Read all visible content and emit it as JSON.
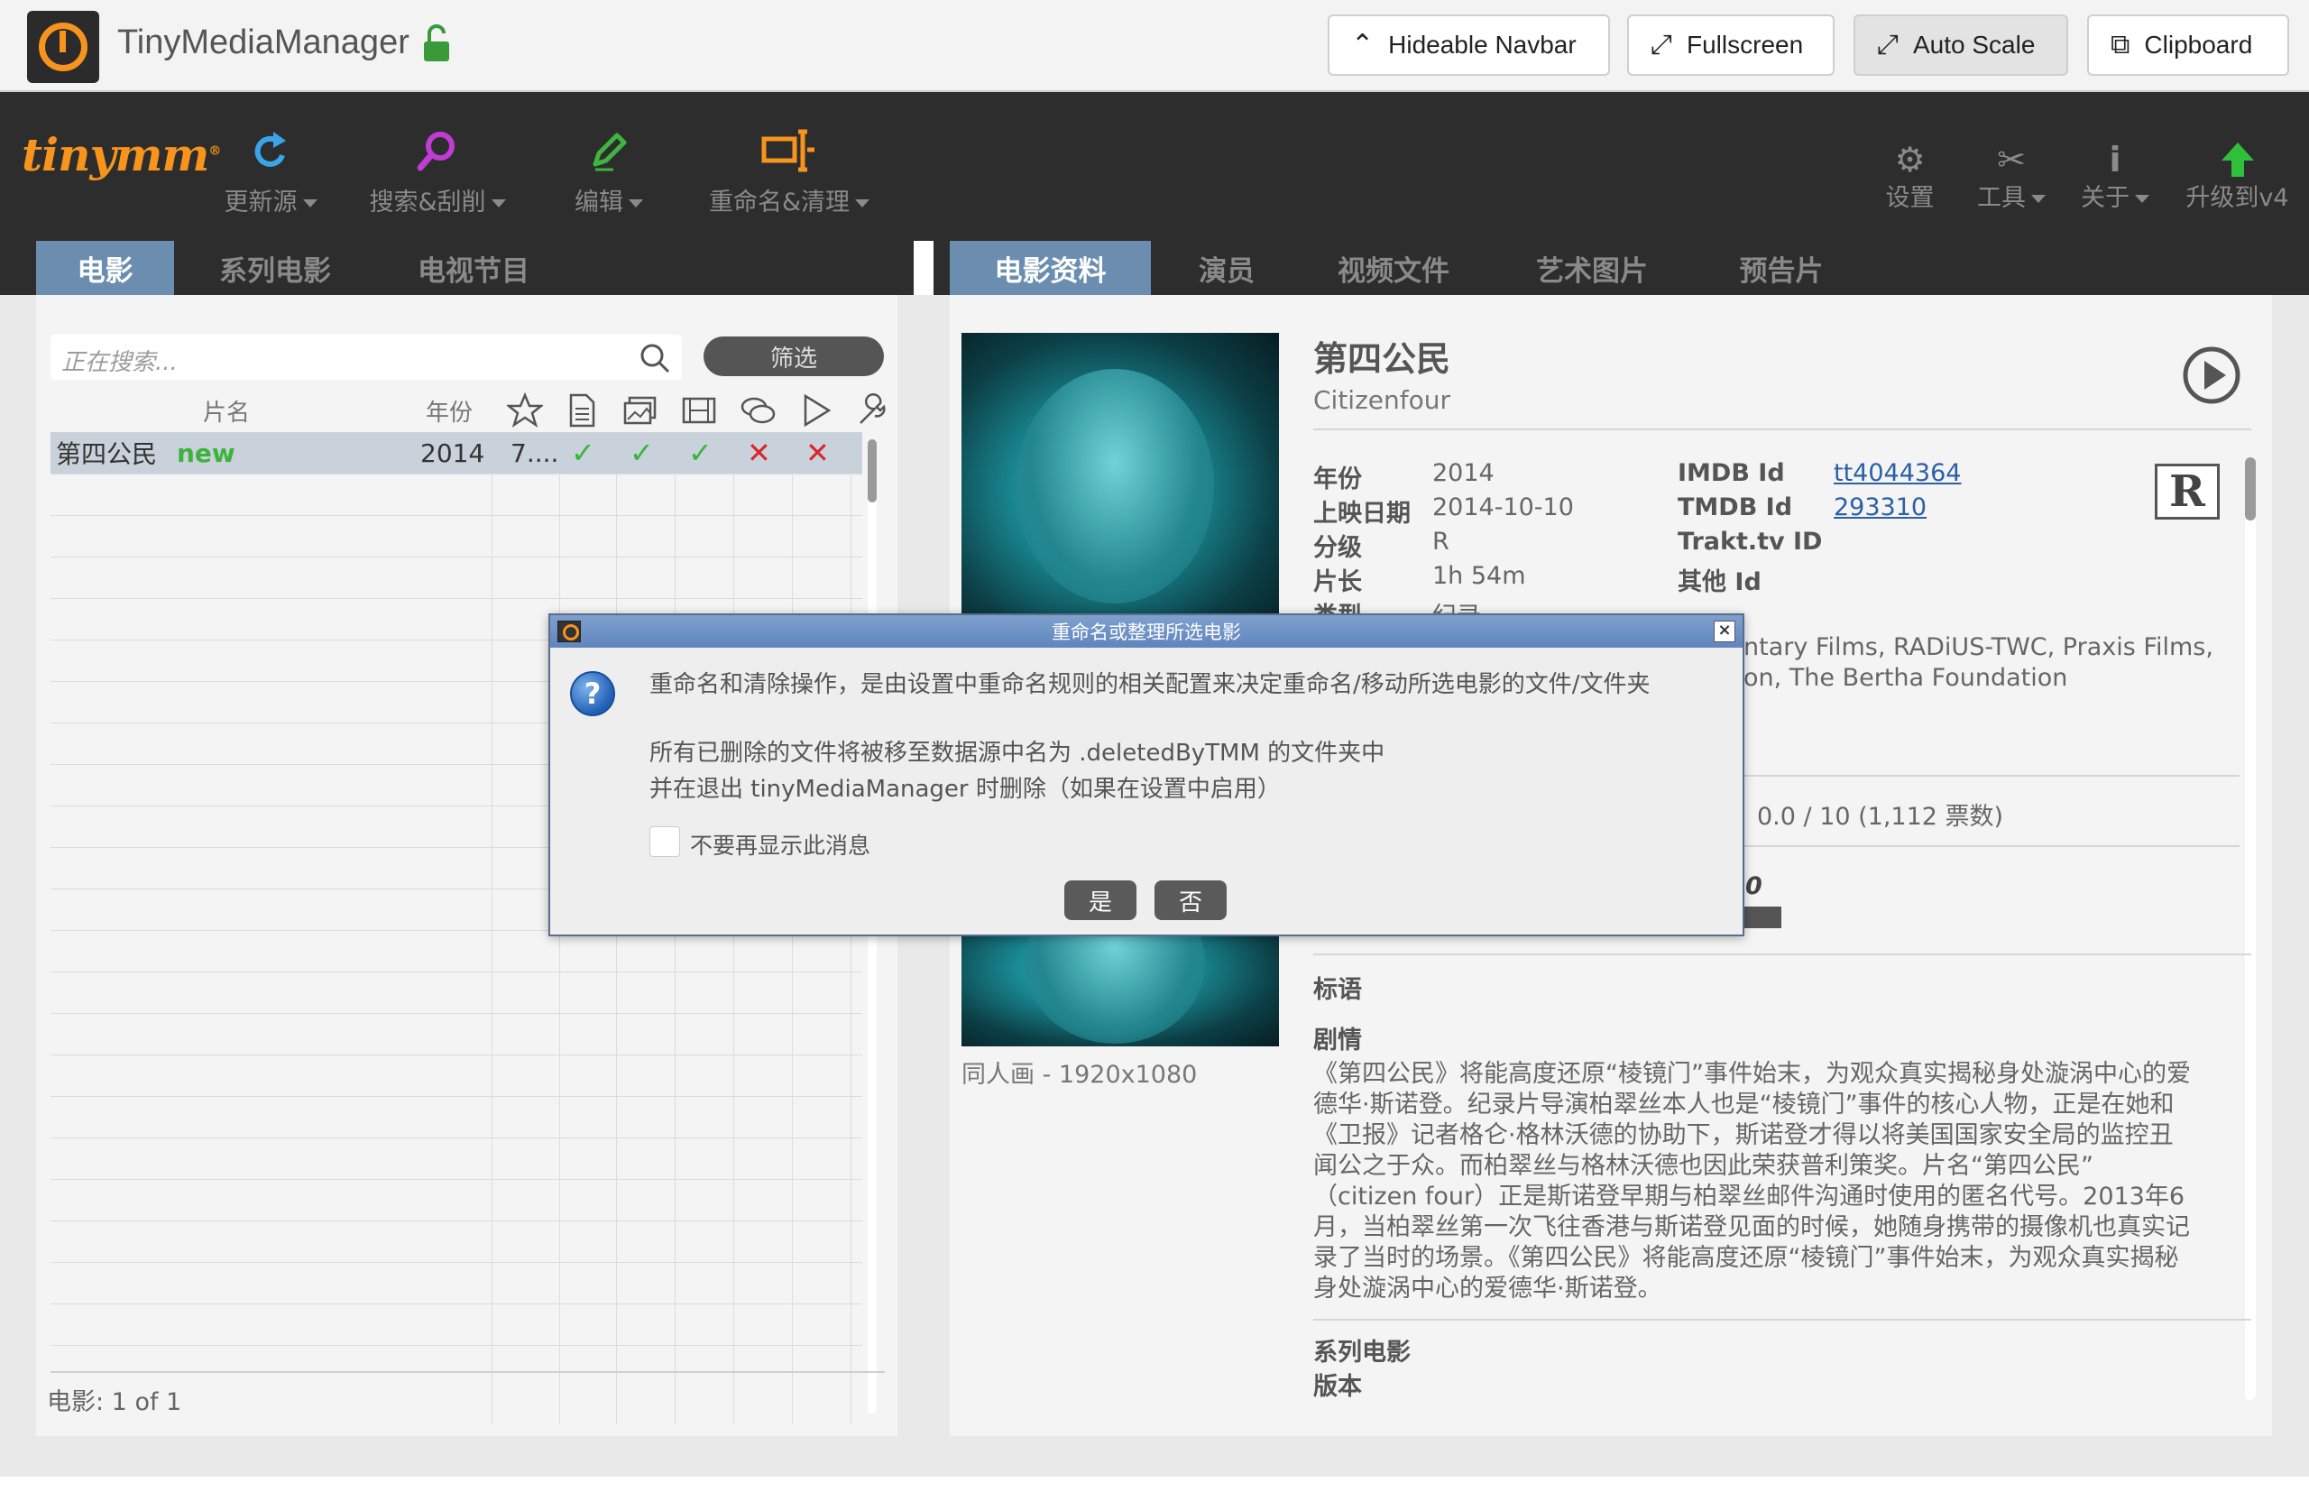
{
  "topbar": {
    "app_title": "TinyMediaManager",
    "buttons": {
      "hideable_navbar": "Hideable Navbar",
      "fullscreen": "Fullscreen",
      "auto_scale": "Auto Scale",
      "clipboard": "Clipboard"
    }
  },
  "toolbar": {
    "brand": "tinymm",
    "items": {
      "update": "更新源",
      "search": "搜索&刮削",
      "edit": "编辑",
      "rename": "重命名&清理",
      "settings": "设置",
      "tools": "工具",
      "about": "关于",
      "upgrade": "升级到v4"
    }
  },
  "left_tabs": [
    "电影",
    "系列电影",
    "电视节目"
  ],
  "right_tabs": [
    "电影资料",
    "演员",
    "视频文件",
    "艺术图片",
    "预告片"
  ],
  "movie_list": {
    "search_placeholder": "正在搜索...",
    "filter_label": "筛选",
    "columns": {
      "title": "片名",
      "year": "年份"
    },
    "rows": [
      {
        "title": "第四公民",
        "badge": "new",
        "year": "2014",
        "rating": "7...."
      }
    ],
    "status": "电影:  1  of  1"
  },
  "movie_detail": {
    "title": "第四公民",
    "original_title": "Citizenfour",
    "labels": {
      "year": "年份",
      "release_date": "上映日期",
      "certification": "分级",
      "runtime": "片长",
      "genre": "类型",
      "imdb": "IMDB Id",
      "tmdb": "TMDB Id",
      "trakt": "Trakt.tv ID",
      "other_id": "其他 Id",
      "tagline": "标语",
      "plot": "剧情",
      "movieset": "系列电影",
      "edition": "版本"
    },
    "values": {
      "year": "2014",
      "release_date": "2014-10-10",
      "certification": "R",
      "runtime": "1h 54m",
      "genre": "纪录",
      "imdb": "tt4044364",
      "tmdb": "293310"
    },
    "rating_badge": "R",
    "production_line1": "ntary Films, RADiUS-TWC, Praxis Films,",
    "production_line2": "on, The Bertha Foundation",
    "rating_text": "0.0 / 10  (1,112 票数)",
    "fanart_caption": "同人画 - 1920x1080",
    "plot_lines": [
      "《第四公民》将能高度还原“棱镜门”事件始末，为观众真实揭秘身处漩涡中心的爱",
      "德华·斯诺登。纪录片导演柏翠丝本人也是“棱镜门”事件的核心人物，正是在她和",
      "《卫报》记者格仑·格林沃德的协助下，斯诺登才得以将美国国家安全局的监控丑",
      "闻公之于众。而柏翠丝与格林沃德也因此荣获普利策奖。片名“第四公民”",
      "（citizen four）正是斯诺登早期与柏翠丝邮件沟通时使用的匿名代号。2013年6",
      "月，当柏翠丝第一次飞往香港与斯诺登见面的时候，她随身携带的摄像机也真实记",
      "录了当时的场景。《第四公民》将能高度还原“棱镜门”事件始末，为观众真实揭秘",
      "身处漩涡中心的爱德华·斯诺登。"
    ]
  },
  "dialog": {
    "title": "重命名或整理所选电影",
    "line1": "重命名和清除操作，是由设置中重命名规则的相关配置来决定重命名/移动所选电影的文件/文件夹",
    "line2": "所有已删除的文件将被移至数据源中名为 .deletedByTMM 的文件夹中",
    "line3": "并在退出 tinyMediaManager 时删除（如果在设置中启用）",
    "checkbox_label": "不要再显示此消息",
    "yes": "是",
    "no": "否"
  },
  "colors": {
    "accent_orange": "#f7941d",
    "tab_active": "#6b8eb0",
    "toolbar_bg": "#2d2d2d",
    "check_green": "#3cb43c",
    "cross_red": "#d9262c",
    "new_green": "#3cb43c"
  }
}
